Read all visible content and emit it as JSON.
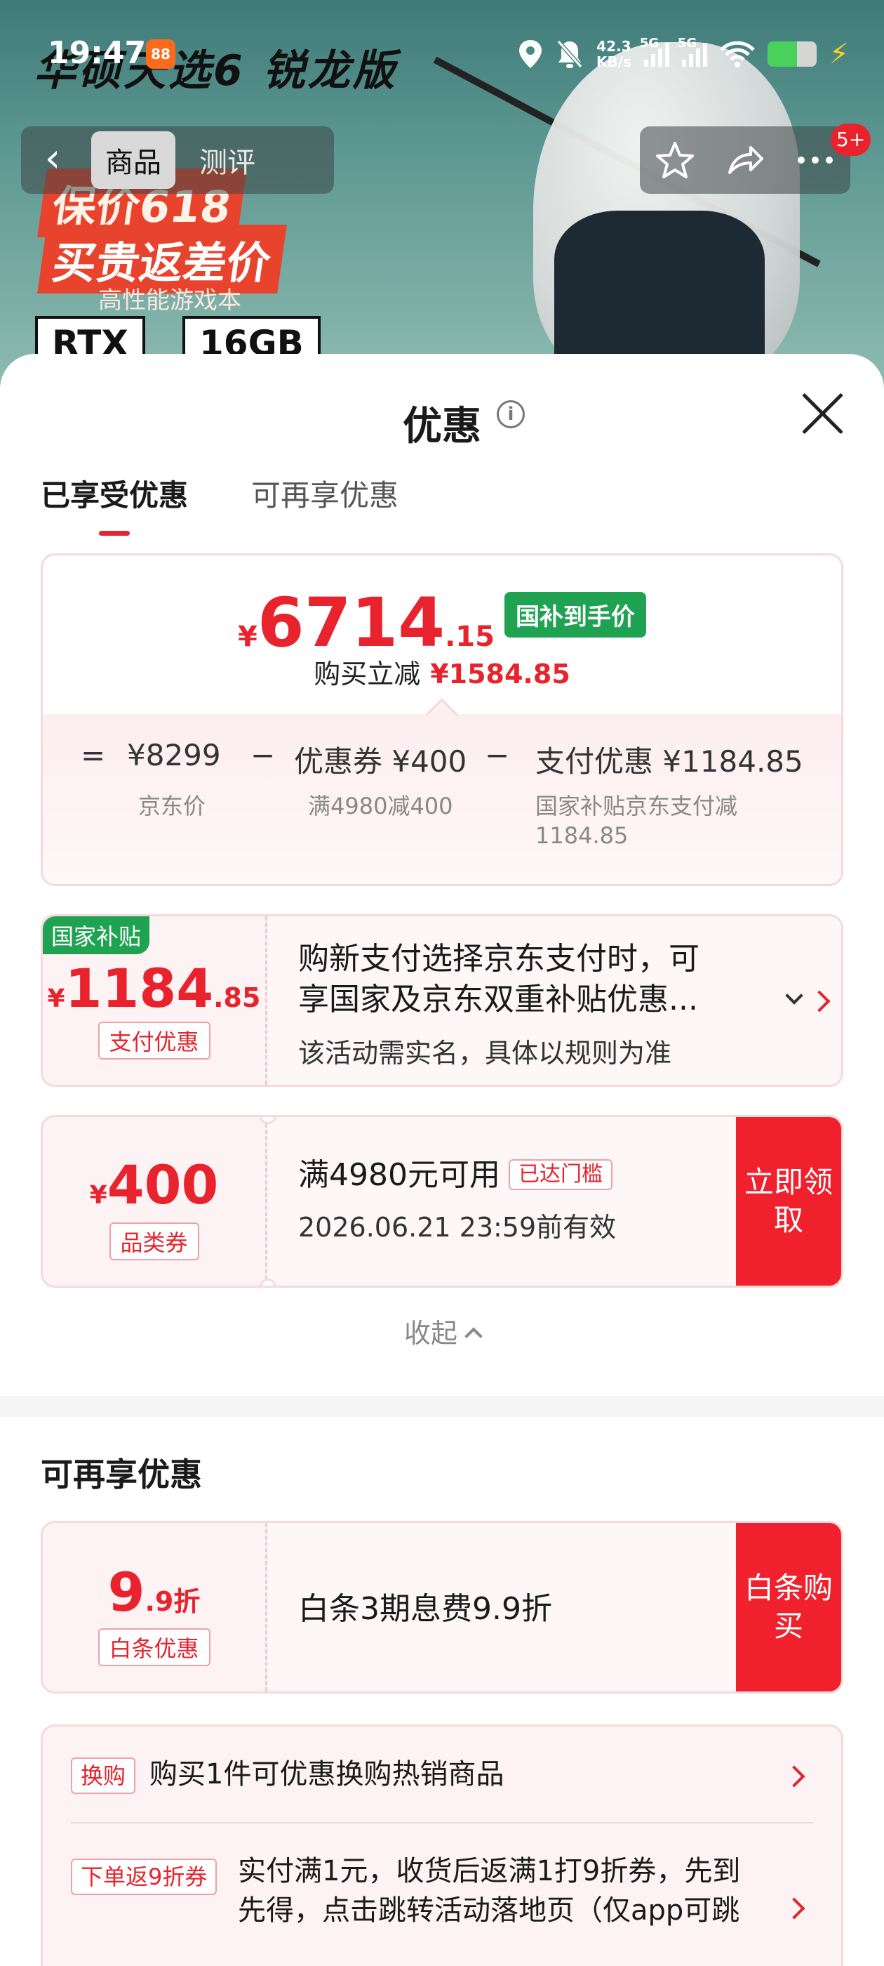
{
  "status_bar": {
    "time": "19:47",
    "app_badge": "88",
    "net_speed_value": "42.3",
    "net_speed_unit": "KB/s",
    "signal1": "5G",
    "signal2": "5G"
  },
  "hero": {
    "title": "华硕天选6 锐龙版",
    "promo_line1": "保价618",
    "promo_line2": "买贵返差价",
    "promo_sub": "高性能游戏本",
    "spec1": "RTX",
    "spec2": "16GB"
  },
  "nav": {
    "back_label": "‹",
    "tabs": [
      "商品",
      "测评"
    ],
    "more_count": "5+"
  },
  "sheet": {
    "title": "优惠",
    "info_icon": "i",
    "tabs": [
      "已享受优惠",
      "可再享优惠"
    ]
  },
  "summary": {
    "yen": "¥",
    "price_int": "6714",
    "price_dec": ".15",
    "price_tag": "国补到手价",
    "reduce_label": "购买立减",
    "reduce_amount": "¥1584.85",
    "eq": "=",
    "minus": "−",
    "jd_price": "¥8299",
    "jd_price_label": "京东价",
    "coupon": "优惠券 ¥400",
    "coupon_label": "满4980减400",
    "pay": "支付优惠 ¥1184.85",
    "pay_label_line1": "国家补贴京东支付减",
    "pay_label_line2": "1184.85"
  },
  "card_subsidy": {
    "corner": "国家补贴",
    "yen": "¥",
    "int": "1184",
    "dec": ".85",
    "pill": "支付优惠",
    "text_line1": "购新支付选择京东支付时，可",
    "text_line2": "享国家及京东双重补贴优惠...",
    "sub": "该活动需实名，具体以规则为准"
  },
  "card_coupon": {
    "yen": "¥",
    "int": "400",
    "pill": "品类券",
    "text": "满4980元可用",
    "ok_tag": "已达门槛",
    "expire": "2026.06.21 23:59前有效",
    "cta": "立即领取"
  },
  "collapse_label": "收起",
  "section2": {
    "title": "可再享优惠",
    "baitiao": {
      "int": "9",
      "dec": ".9折",
      "pill": "白条优惠",
      "text": "白条3期息费9.9折",
      "cta": "白条购买"
    },
    "list": [
      {
        "tag": "换购",
        "text": "购买1件可优惠换购热销商品"
      },
      {
        "tag": "下单返9折券",
        "text_line1": "实付满1元，收货后返满1打9折券，先到",
        "text_line2": "先得，点击跳转活动落地页（仅app可跳"
      }
    ]
  },
  "colors": {
    "accent_red": "#e8232d",
    "subsidy_green": "#1fa352",
    "card_border": "#f6d9dc"
  }
}
